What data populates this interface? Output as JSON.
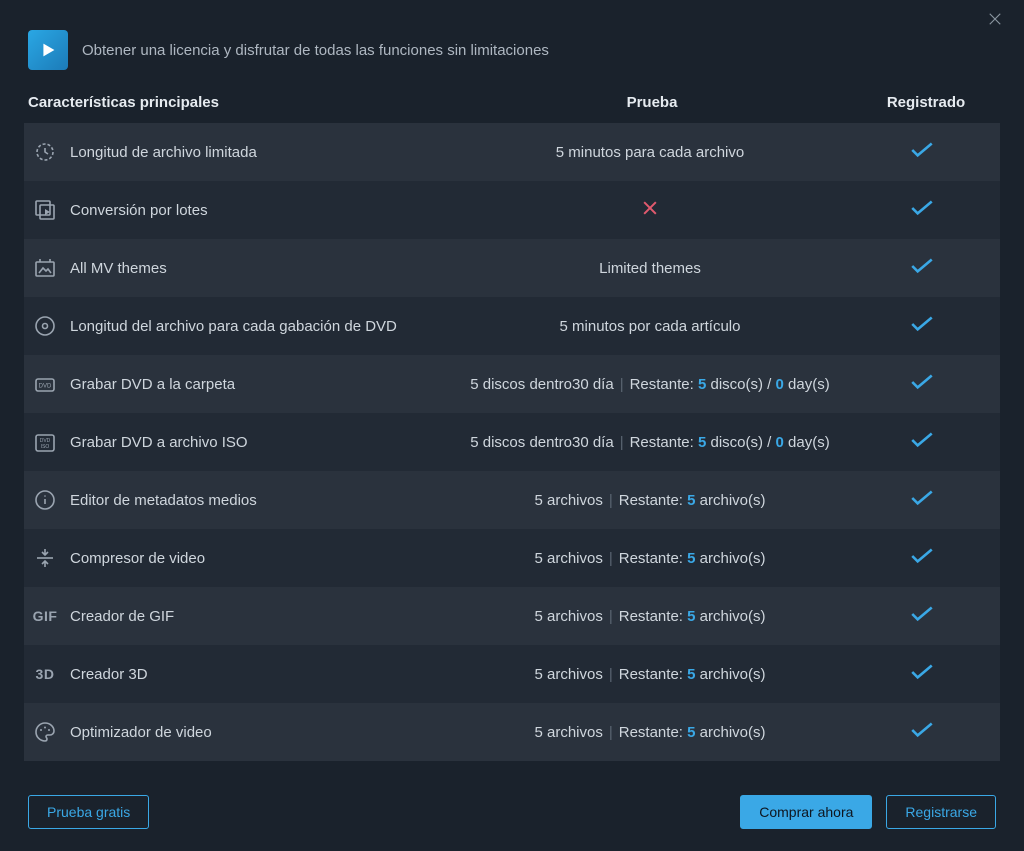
{
  "header": {
    "title": "Obtener una licencia y disfrutar de todas las funciones sin limitaciones"
  },
  "columns": {
    "features": "Características principales",
    "trial": "Prueba",
    "registered": "Registrado"
  },
  "labels": {
    "remaining": "Restante:",
    "files": "archivo(s)",
    "discs": "disco(s)",
    "days": "day(s)",
    "files_short": "archivos",
    "discs_limit": "5 discos dentro30 día"
  },
  "rows": {
    "r0": {
      "label": "Longitud de archivo limitada",
      "trial_text": "5 minutos para cada archivo"
    },
    "r1": {
      "label": "Conversión por lotes"
    },
    "r2": {
      "label": "All MV themes",
      "trial_text": "Limited themes"
    },
    "r3": {
      "label": "Longitud del archivo para cada gabación de DVD",
      "trial_text": "5 minutos por cada artículo"
    },
    "r4": {
      "label": "Grabar DVD a la carpeta",
      "discs": "5",
      "days": "0"
    },
    "r5": {
      "label": "Grabar DVD a archivo ISO",
      "discs": "5",
      "days": "0"
    },
    "r6": {
      "label": "Editor de metadatos medios",
      "files": "5"
    },
    "r7": {
      "label": "Compresor de video",
      "files": "5"
    },
    "r8": {
      "label": "Creador de GIF",
      "files": "5",
      "icon_text": "GIF"
    },
    "r9": {
      "label": "Creador 3D",
      "files": "5",
      "icon_text": "3D"
    },
    "r10": {
      "label": "Optimizador de video",
      "files": "5"
    }
  },
  "footer": {
    "free_trial": "Prueba gratis",
    "buy_now": "Comprar ahora",
    "register": "Registrarse"
  }
}
